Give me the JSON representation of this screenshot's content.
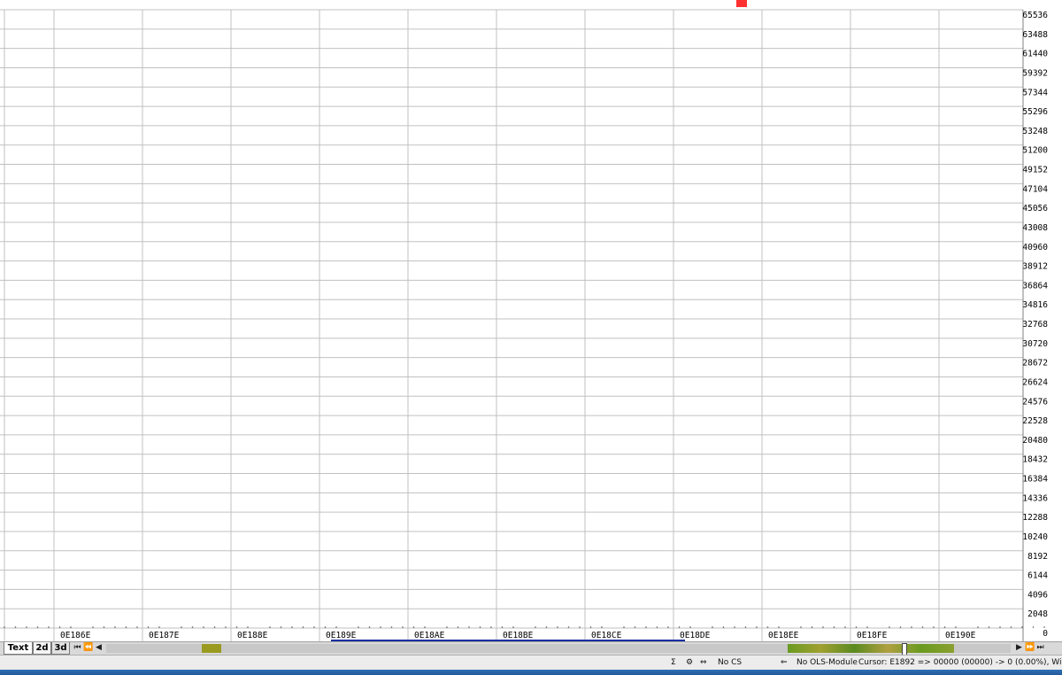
{
  "y_axis_labels": [
    "65536",
    "63488",
    "61440",
    "59392",
    "57344",
    "55296",
    "53248",
    "51200",
    "49152",
    "47104",
    "45056",
    "43008",
    "40960",
    "38912",
    "36864",
    "34816",
    "32768",
    "30720",
    "28672",
    "26624",
    "24576",
    "22528",
    "20480",
    "18432",
    "16384",
    "14336",
    "12288",
    "10240",
    "8192",
    "6144",
    "4096",
    "2048",
    "0"
  ],
  "x_axis_labels": [
    "0E186E",
    "0E187E",
    "0E188E",
    "0E189E",
    "0E18AE",
    "0E18BE",
    "0E18CE",
    "0E18DE",
    "0E18EE",
    "0E18FE",
    "0E190E"
  ],
  "tabs": {
    "text": "Text",
    "two_d": "2d",
    "three_d": "3d"
  },
  "status": {
    "checksum": "No CS",
    "module": "No OLS-Module",
    "cursor": "Cursor: E1892 => 00000 (00000) -> 0 (0.00%), Width: 8"
  },
  "colors": {
    "grid": "#c0c0c0",
    "line": "#000000",
    "highlight": "#c00000",
    "marker": "#ff3030",
    "selection": "#1a2fa0"
  },
  "chart_data": {
    "type": "line",
    "x_unit": "address offset from 0E186E",
    "ylim": [
      0,
      65536
    ],
    "x_ticks": [
      "0E186E",
      "0E187E",
      "0E188E",
      "0E189E",
      "0E18AE",
      "0E18BE",
      "0E18CE",
      "0E18DE",
      "0E18EE",
      "0E18FE",
      "0E190E"
    ],
    "segments": [
      {
        "highlight": false,
        "points": [
          [
            118,
            0
          ],
          [
            120,
            1000
          ],
          [
            121,
            64500
          ],
          [
            122,
            500
          ]
        ]
      },
      {
        "highlight": true,
        "points": [
          [
            123,
            24500
          ],
          [
            124,
            13200
          ],
          [
            125,
            21700
          ]
        ]
      },
      {
        "highlight": false,
        "points": [
          [
            125,
            21700
          ],
          [
            126,
            13800
          ]
        ]
      },
      {
        "highlight": false,
        "points": [
          [
            126.5,
            8500
          ],
          [
            127,
            65536
          ],
          [
            128,
            65536
          ],
          [
            129,
            65536
          ],
          [
            130,
            65536
          ],
          [
            131,
            0
          ],
          [
            132,
            3300
          ],
          [
            133,
            0
          ]
        ]
      },
      {
        "highlight": false,
        "points": [
          [
            133.5,
            4400
          ],
          [
            134,
            0
          ],
          [
            135,
            4400
          ],
          [
            136,
            500
          ],
          [
            137,
            65536
          ],
          [
            138,
            500
          ],
          [
            139,
            200
          ],
          [
            140,
            200
          ]
        ]
      },
      {
        "highlight": false,
        "points": [
          [
            141,
            18100
          ],
          [
            142,
            0
          ],
          [
            143,
            22500
          ],
          [
            144,
            0
          ],
          [
            145,
            22500
          ],
          [
            146,
            500
          ],
          [
            147,
            32500
          ],
          [
            147.5,
            65536
          ]
        ]
      }
    ],
    "baseline_dots_range": [
      0,
      118
    ]
  }
}
